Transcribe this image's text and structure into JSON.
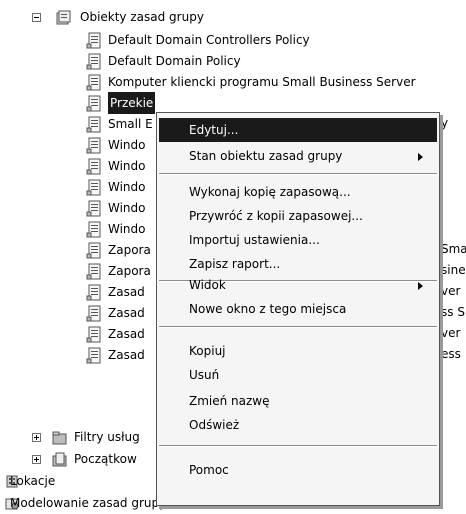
{
  "tree": {
    "gpo_root": "Obiekty zasad grupy",
    "items": [
      "Default Domain Controllers Policy",
      "Default Domain Policy",
      "Komputer kliencki programu Small Business Server",
      "Przekierowanie folderów...",
      "Small Business Server ...",
      "Windows ...",
      "Windows ...",
      "Windows ...",
      "Windows ...",
      "Windows ...",
      "Zapora ... Small",
      "Zapora ... Business",
      "Zasady ... Server",
      "Zasady ... Business S",
      "Zasady ... Server",
      "Zasady ... Business"
    ],
    "item_visible": [
      "Default Domain Controllers Policy",
      "Default Domain Policy",
      "Komputer kliencki programu Small Business Server",
      "Przekie",
      "Small E",
      "Windo",
      "Windo",
      "Windo",
      "Windo",
      "Windo",
      "Zapora",
      "Zapora",
      "Zasad",
      "Zasad",
      "Zasad",
      "Zasad"
    ],
    "item_right": [
      "",
      "",
      "",
      "",
      "y",
      "",
      "",
      "",
      "",
      "",
      "Smal",
      "sines",
      "ver",
      "ss S",
      "ver",
      "ess"
    ],
    "filters": "Filtry usług",
    "starter": "Początkow",
    "locations": "Lokacje",
    "modeling": "Modelowanie zasad grupy"
  },
  "menu": {
    "edit": "Edytuj...",
    "gpo_status": "Stan obiektu zasad grupy",
    "backup": "Wykonaj kopię zapasową...",
    "restore": "Przywróć z kopii zapasowej...",
    "import": "Importuj ustawienia...",
    "save_report": "Zapisz raport...",
    "view": "Widok",
    "new_window": "Nowe okno z tego miejsca",
    "copy": "Kopiuj",
    "delete": "Usuń",
    "rename": "Zmień nazwę",
    "refresh": "Odśwież",
    "help": "Pomoc"
  }
}
